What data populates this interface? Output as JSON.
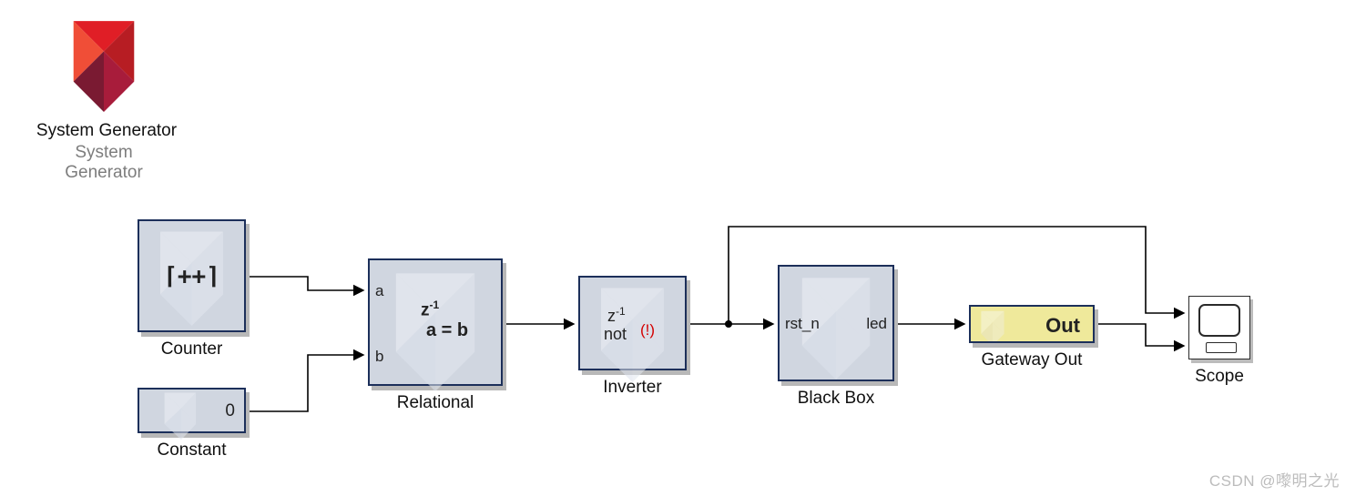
{
  "sysgen": {
    "title": "System Generator",
    "sub1": "System",
    "sub2": "Generator"
  },
  "watermark": "CSDN @嚟明之光",
  "blocks": {
    "counter": {
      "label": "Counter",
      "symbol": "⌈++⌉"
    },
    "constant": {
      "label": "Constant",
      "value": "0"
    },
    "relational": {
      "label": "Relational",
      "expr": "a = b",
      "port_a": "a",
      "port_b": "b",
      "z1": "z",
      "z1exp": "-1"
    },
    "inverter": {
      "label": "Inverter",
      "op": "not",
      "warn": "(!)",
      "z1": "z",
      "z1exp": "-1"
    },
    "blackbox": {
      "label": "Black Box",
      "in": "rst_n",
      "out": "led"
    },
    "gateway": {
      "label": "Gateway Out",
      "text": "Out"
    },
    "scope": {
      "label": "Scope"
    }
  }
}
